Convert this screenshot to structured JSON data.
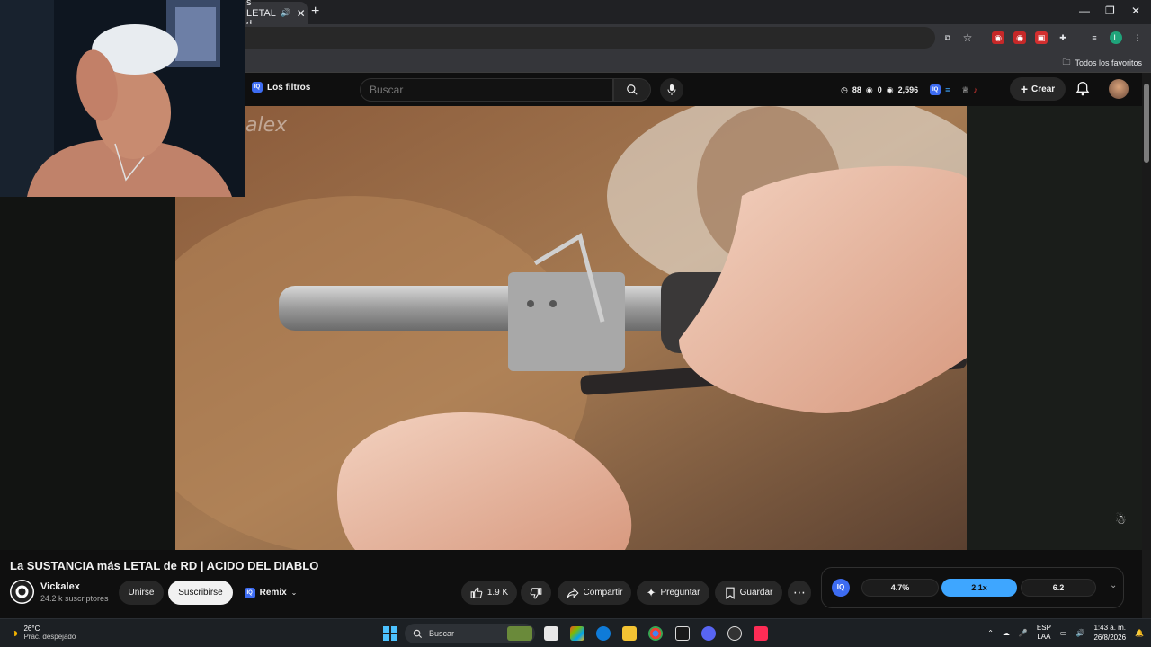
{
  "browser": {
    "tab_title": "s LETAL d",
    "tab_close": "✕",
    "new_tab": "+",
    "bookmarks_label": "Todos los favoritos"
  },
  "header": {
    "filters_label": "Los filtros",
    "search_placeholder": "Buscar",
    "stat_clock": "88",
    "stat_eye1": "0",
    "stat_views": "2,596",
    "create_label": "Crear"
  },
  "video": {
    "watermark": "alex"
  },
  "info": {
    "title": "La SUSTANCIA más LETAL de RD | ACIDO DEL DIABLO",
    "channel_name": "Vickalex",
    "subscribers": "24.2 k suscriptores",
    "join_label": "Unirse",
    "subscribe_label": "Suscribirse",
    "remix_label": "Remix",
    "likes": "1.9 K",
    "share_label": "Compartir",
    "ask_label": "Preguntar",
    "save_label": "Guardar"
  },
  "speed_panel": {
    "left": "4.7%",
    "middle": "2.1x",
    "right": "6.2"
  },
  "taskbar": {
    "temperature": "26°C",
    "weather_desc": "Prac. despejado",
    "search_label": "Buscar",
    "lang_top": "ESP",
    "lang_bottom": "LAA",
    "time": "1:43 a. m.",
    "date": "26/8/2026"
  },
  "colors": {
    "accent_blue": "#3ea6ff",
    "iq_blue": "#3d6cf2",
    "background": "#0f0f0f"
  }
}
